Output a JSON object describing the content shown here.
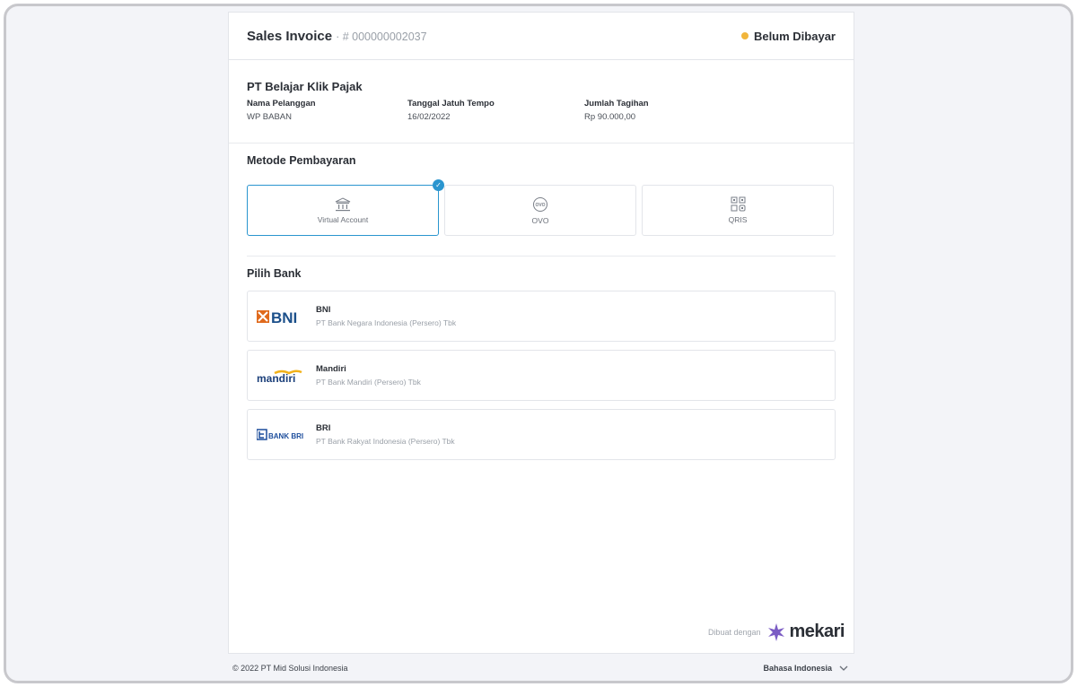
{
  "invoice": {
    "title": "Sales Invoice",
    "number": "· # 000000002037",
    "status": "Belum Dibayar",
    "status_color": "#f1b53b"
  },
  "company": {
    "name": "PT Belajar Klik Pajak",
    "fields": [
      {
        "label": "Nama Pelanggan",
        "value": "WP BABAN"
      },
      {
        "label": "Tanggal Jatuh Tempo",
        "value": "16/02/2022"
      },
      {
        "label": "Jumlah Tagihan",
        "value": "Rp 90.000,00"
      }
    ]
  },
  "payment": {
    "title": "Metode Pembayaran",
    "methods": [
      {
        "label": "Virtual Account",
        "icon": "bank-building-icon",
        "selected": true
      },
      {
        "label": "OVO",
        "icon": "ovo-icon",
        "selected": false
      },
      {
        "label": "QRIS",
        "icon": "qr-code-icon",
        "selected": false
      }
    ],
    "accent": "#2a95cf"
  },
  "banks": {
    "title": "Pilih Bank",
    "items": [
      {
        "name": "BNI",
        "full": "PT Bank Negara Indonesia (Persero) Tbk",
        "logo_text": "BNI"
      },
      {
        "name": "Mandiri",
        "full": "PT Bank Mandiri (Persero) Tbk",
        "logo_text": "mandiri"
      },
      {
        "name": "BRI",
        "full": "PT Bank Rakyat Indonesia (Persero) Tbk",
        "logo_text": "BANK BRI"
      }
    ]
  },
  "branding": {
    "made_with": "Dibuat dengan",
    "brand": "mekari",
    "brand_color": "#7b5cc4"
  },
  "footer": {
    "copyright": "© 2022 PT Mid Solusi Indonesia",
    "language": "Bahasa Indonesia"
  }
}
